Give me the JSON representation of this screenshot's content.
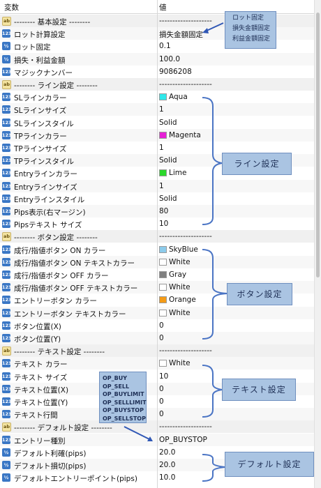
{
  "header": {
    "col_name": "変数",
    "col_value": "値"
  },
  "rows": [
    {
      "kind": "sec",
      "name": "--------  基本設定  --------",
      "value": "--------------------"
    },
    {
      "kind": "num",
      "name": "ロット計算設定",
      "value": "損失金額固定"
    },
    {
      "kind": "half",
      "name": "ロット固定",
      "value": "0.1"
    },
    {
      "kind": "half",
      "name": "損失・利益金額",
      "value": "100.0"
    },
    {
      "kind": "num",
      "name": "マジックナンバー",
      "value": "9086208"
    },
    {
      "kind": "sec",
      "name": "--------  ライン設定  --------",
      "value": "--------------------"
    },
    {
      "kind": "num",
      "name": "SLラインカラー",
      "value": "Aqua",
      "swatch": "#2fe8ea"
    },
    {
      "kind": "num",
      "name": "SLラインサイズ",
      "value": "1"
    },
    {
      "kind": "num",
      "name": "SLラインスタイル",
      "value": "Solid"
    },
    {
      "kind": "num",
      "name": "TPラインカラー",
      "value": "Magenta",
      "swatch": "#e620d6"
    },
    {
      "kind": "num",
      "name": "TPラインサイズ",
      "value": "1"
    },
    {
      "kind": "num",
      "name": "TPラインスタイル",
      "value": "Solid"
    },
    {
      "kind": "num",
      "name": "Entryラインカラー",
      "value": "Lime",
      "swatch": "#2bd82b"
    },
    {
      "kind": "num",
      "name": "Entryラインサイズ",
      "value": "1"
    },
    {
      "kind": "num",
      "name": "Entryラインスタイル",
      "value": "Solid"
    },
    {
      "kind": "num",
      "name": "Pips表示(右マージン)",
      "value": "80"
    },
    {
      "kind": "num",
      "name": "Pipsテキスト サイズ",
      "value": "10"
    },
    {
      "kind": "sec",
      "name": "--------  ボタン設定  --------",
      "value": "--------------------"
    },
    {
      "kind": "num",
      "name": "成行/指値ボタン ON カラー",
      "value": "SkyBlue",
      "swatch": "#8ccbeb"
    },
    {
      "kind": "num",
      "name": "成行/指値ボタン ON テキストカラー",
      "value": "White",
      "swatch": "#ffffff"
    },
    {
      "kind": "num",
      "name": "成行/指値ボタン OFF カラー",
      "value": "Gray",
      "swatch": "#808080"
    },
    {
      "kind": "num",
      "name": "成行/指値ボタン OFF テキストカラー",
      "value": "White",
      "swatch": "#ffffff"
    },
    {
      "kind": "num",
      "name": "エントリーボタン カラー",
      "value": "Orange",
      "swatch": "#f49b16"
    },
    {
      "kind": "num",
      "name": "エントリーボタン テキストカラー",
      "value": "White",
      "swatch": "#ffffff"
    },
    {
      "kind": "num",
      "name": "ボタン位置(X)",
      "value": "0"
    },
    {
      "kind": "num",
      "name": "ボタン位置(Y)",
      "value": "0"
    },
    {
      "kind": "sec",
      "name": "--------  テキスト設定  --------",
      "value": "--------------------"
    },
    {
      "kind": "num",
      "name": "テキスト カラー",
      "value": "White",
      "swatch": "#ffffff"
    },
    {
      "kind": "num",
      "name": "テキスト サイズ",
      "value": "10"
    },
    {
      "kind": "num",
      "name": "テキスト位置(X)",
      "value": "0"
    },
    {
      "kind": "num",
      "name": "テキスト位置(Y)",
      "value": "0"
    },
    {
      "kind": "num",
      "name": "テキスト行間",
      "value": "0"
    },
    {
      "kind": "sec",
      "name": "--------  デフォルト設定  --------",
      "value": "--------------------"
    },
    {
      "kind": "num",
      "name": "エントリー種別",
      "value": "OP_BUYSTOP"
    },
    {
      "kind": "half",
      "name": "デフォルト利確(pips)",
      "value": "20.0"
    },
    {
      "kind": "half",
      "name": "デフォルト損切(pips)",
      "value": "20.0"
    },
    {
      "kind": "half",
      "name": "デフォルトエントリーポイント(pips)",
      "value": "10.0"
    }
  ],
  "annotations": {
    "lot_modes": [
      "ロット固定",
      "損失金額固定",
      "利益金額固定"
    ],
    "line_settings": "ライン設定",
    "button_settings": "ボタン設定",
    "text_settings": "テキスト設定",
    "default_settings": "デフォルト設定",
    "order_types": [
      "OP_BUY",
      "OP_SELL",
      "OP_BUYLIMIT",
      "OP_SELLLIMIT",
      "OP_BUYSTOP",
      "OP_SELLSTOP"
    ]
  },
  "icons": {
    "num": "integer-param-icon",
    "half": "double-param-icon",
    "sec": "string-param-icon"
  },
  "colors": {
    "callout_fill": "#aac4e2",
    "callout_border": "#6f8fbf",
    "bracket": "#4a74c4",
    "section_row": "#f0f0f0",
    "alt_row": "#f7f7f7"
  }
}
